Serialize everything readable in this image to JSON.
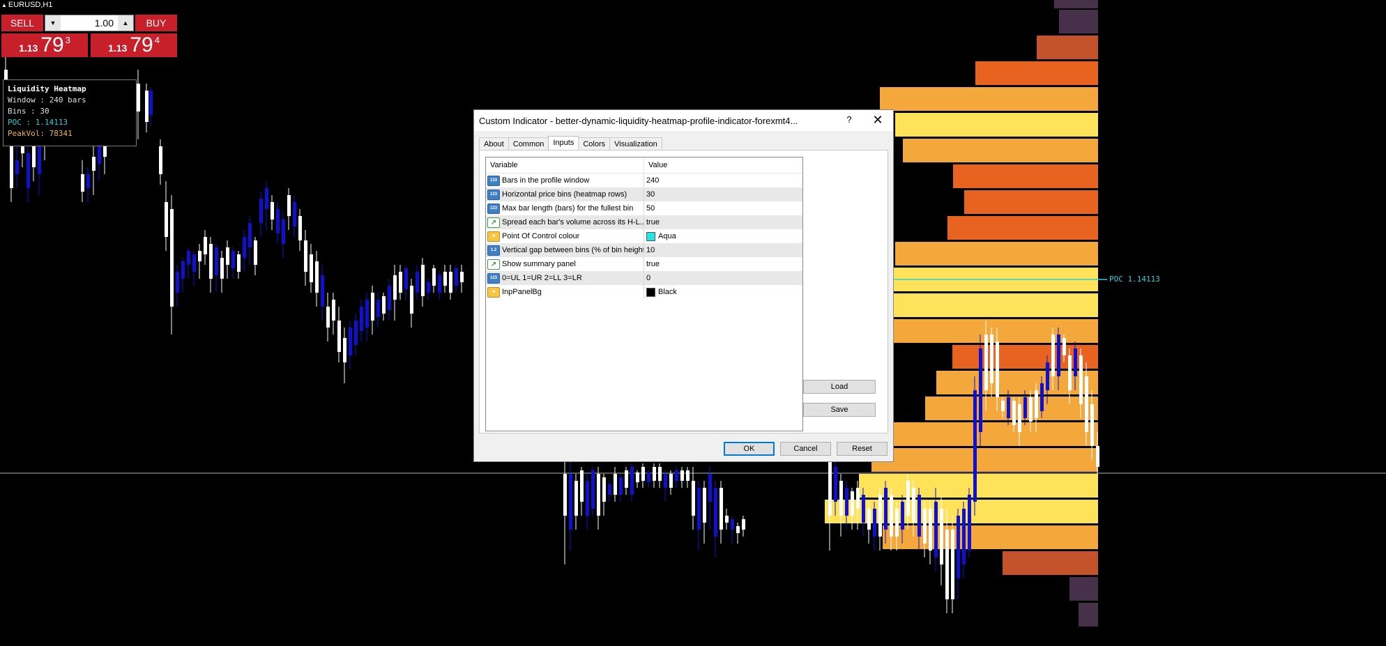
{
  "chart": {
    "symbol": "EURUSD,H1",
    "poc_label": "POC 1.14113"
  },
  "trade_panel": {
    "sell_label": "SELL",
    "buy_label": "BUY",
    "lot_value": "1.00",
    "bid": {
      "small": "1.13",
      "big": "79",
      "sup": "3"
    },
    "ask": {
      "small": "1.13",
      "big": "79",
      "sup": "4"
    }
  },
  "info_panel": {
    "title": "Liquidity Heatmap",
    "lines": [
      "Window : 240 bars",
      "Bins   : 30",
      "POC    : 1.14113",
      "PeakVol: 78341"
    ]
  },
  "dialog": {
    "title": "Custom Indicator - better-dynamic-liquidity-heatmap-profile-indicator-forexmt4...",
    "help": "?",
    "close": "✕",
    "tabs": [
      "About",
      "Common",
      "Inputs",
      "Colors",
      "Visualization"
    ],
    "active_tab": "Inputs",
    "columns": {
      "variable": "Variable",
      "value": "Value"
    },
    "rows": [
      {
        "icon": "int-icon",
        "name": "Bars in the profile window",
        "value": "240"
      },
      {
        "icon": "int-icon",
        "name": "Horizontal price bins (heatmap rows)",
        "value": "30"
      },
      {
        "icon": "int-icon",
        "name": "Max bar length (bars) for the fullest bin",
        "value": "50"
      },
      {
        "icon": "bool-icon",
        "name": "Spread each bar's volume across its H-L...",
        "value": "true"
      },
      {
        "icon": "color-icon",
        "name": "Point Of Control colour",
        "value": "Aqua",
        "swatch": "#22e6e6"
      },
      {
        "icon": "double-icon",
        "name": "Vertical gap between bins (% of bin height)",
        "value": "10"
      },
      {
        "icon": "bool-icon",
        "name": "Show summary panel",
        "value": "true"
      },
      {
        "icon": "int-icon",
        "name": "0=UL 1=UR 2=LL 3=LR",
        "value": "0"
      },
      {
        "icon": "color-icon",
        "name": "InpPanelBg",
        "value": "Black",
        "swatch": "#000000"
      }
    ],
    "buttons": {
      "load": "Load",
      "save": "Save",
      "ok": "OK",
      "cancel": "Cancel",
      "reset": "Reset"
    }
  },
  "colors": {
    "sell_buy": "#c8202a",
    "poc_line": "#22d3dd",
    "bull_candle": "#ffffff",
    "bear_candle": "#1010d0",
    "heat_hot": "#fde25a",
    "heat_warm": "#f4a73a",
    "heat_mid": "#e8631f",
    "heat_cool": "#c4532b",
    "heat_cold": "#46304a"
  }
}
